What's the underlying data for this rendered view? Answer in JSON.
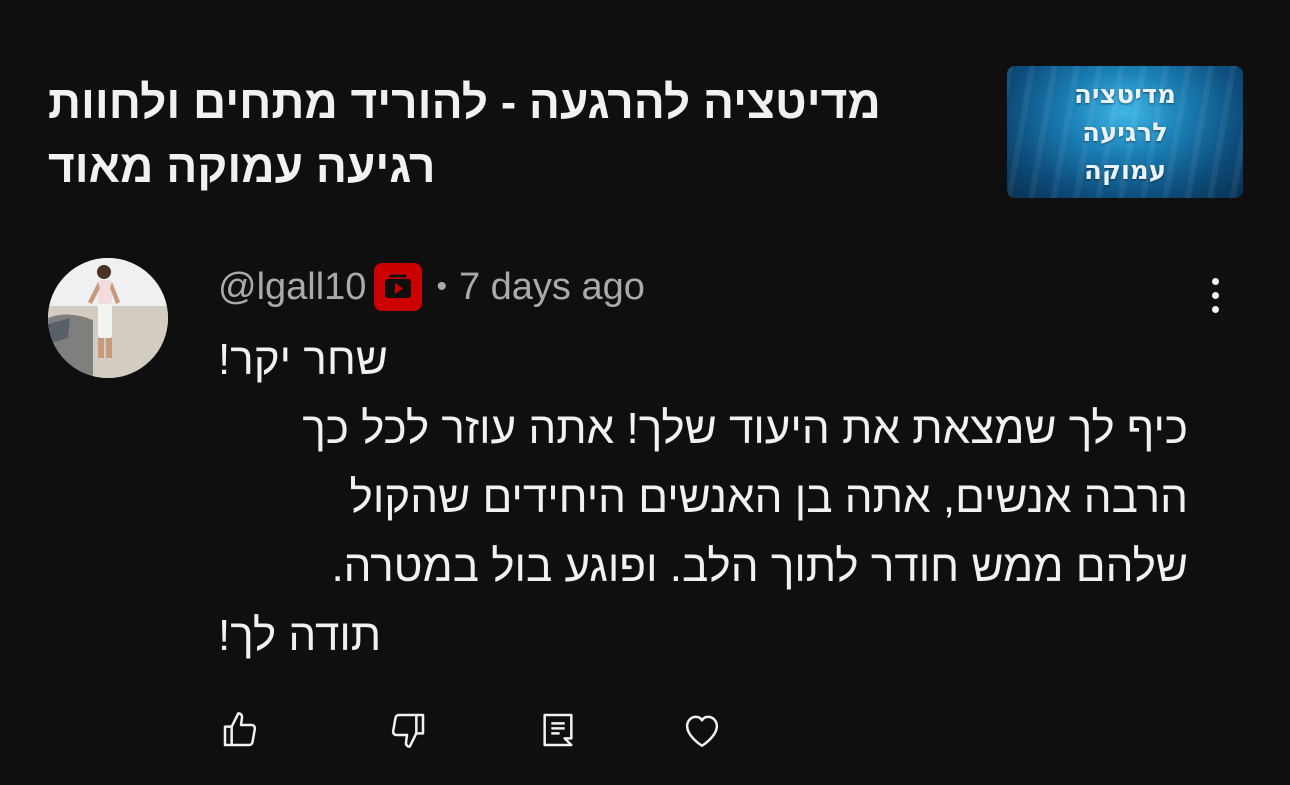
{
  "video": {
    "title": "מדיטציה להרגעה - להוריד מתחים ולחוות רגיעה עמוקה מאוד",
    "thumbnail_text": [
      "מדיטציה",
      "לרגיעה",
      "עמוקה"
    ]
  },
  "comment": {
    "author": "@lgall10",
    "timestamp": "7 days ago",
    "separator": "•",
    "lines": [
      "שחר יקר!",
      "כיף לך שמצאת את היעוד שלך! אתה עוזר לכל כך",
      "הרבה אנשים, אתה בן האנשים היחידים שהקול",
      "שלהם ממש חודר לתוך הלב. ופוגע בול במטרה.",
      "תודה לך!"
    ]
  },
  "icons": {
    "more": "more-vertical-icon",
    "like": "thumbs-up-icon",
    "dislike": "thumbs-down-icon",
    "reply": "reply-comment-icon",
    "heart": "heart-icon",
    "badge": "youtube-member-badge-icon"
  },
  "colors": {
    "background": "#0f0f0f",
    "text_primary": "#f1f1f1",
    "text_secondary": "#aaaaaa",
    "badge_red": "#cc0000"
  }
}
